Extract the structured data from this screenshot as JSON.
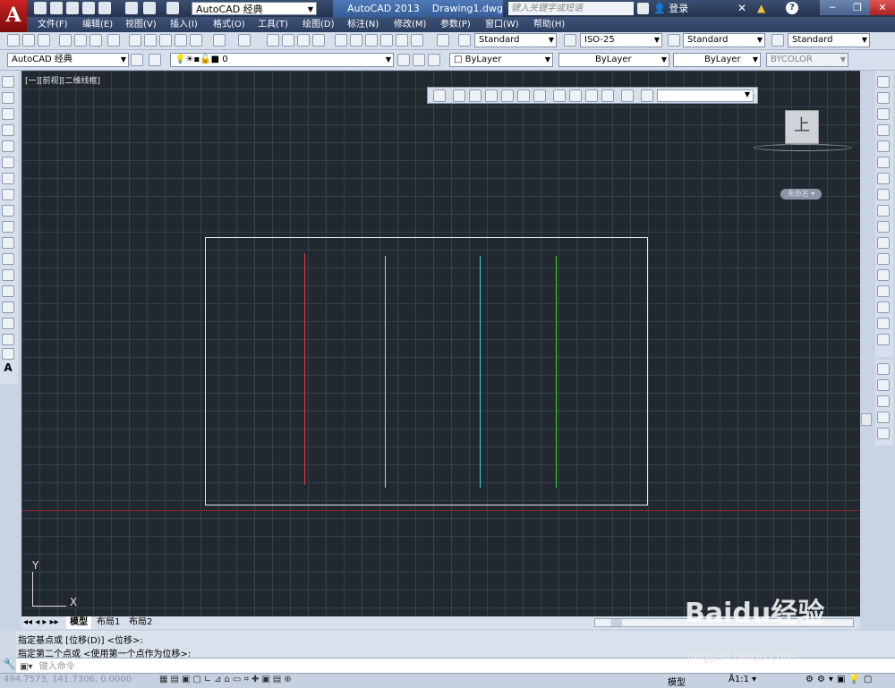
{
  "title_bar": {
    "app_logo": "A",
    "workspace": "AutoCAD 经典",
    "app_name": "AutoCAD 2013",
    "document": "Drawing1.dwg",
    "search_placeholder": "键入关键字或短语",
    "login": "登录",
    "help": "?"
  },
  "menu": [
    "文件(F)",
    "编辑(E)",
    "视图(V)",
    "插入(I)",
    "格式(O)",
    "工具(T)",
    "绘图(D)",
    "标注(N)",
    "修改(M)",
    "参数(P)",
    "窗口(W)",
    "帮助(H)"
  ],
  "styles_toolbar": {
    "text_style": "Standard",
    "dim_style": "ISO-25",
    "table_style": "Standard",
    "multileader_style": "Standard"
  },
  "layers_toolbar": {
    "workspace": "AutoCAD 经典",
    "layer": "0",
    "color": "ByLayer",
    "linetype": "ByLayer",
    "lineweight": "ByLayer",
    "plot_style": "BYCOLOR"
  },
  "canvas": {
    "viewport_label": "[一][前视][二维线框]",
    "viewcube_face": "上",
    "wcs_label": "未命名",
    "ucs_y": "Y",
    "ucs_x": "X",
    "background": "#212830",
    "lines": [
      {
        "name": "red",
        "color": "#e03c3c"
      },
      {
        "name": "yellow",
        "color": "#e8e03a"
      },
      {
        "name": "cyan",
        "color": "#3ad8e8"
      },
      {
        "name": "green",
        "color": "#3ad83a"
      }
    ]
  },
  "tabs": [
    "模型",
    "布局1",
    "布局2"
  ],
  "command": {
    "line1": "指定基点或 [位移(D)] <位移>:",
    "line2": "指定第二个点或 <使用第一个点作为位移>:",
    "input_placeholder": "键入命令"
  },
  "status": {
    "coords": "494.7573, 141.7306, 0.0000",
    "model": "模型",
    "scale": "1:1"
  },
  "watermark": {
    "brand": "Baidu经验",
    "url": "jingyan.baidu.com"
  }
}
